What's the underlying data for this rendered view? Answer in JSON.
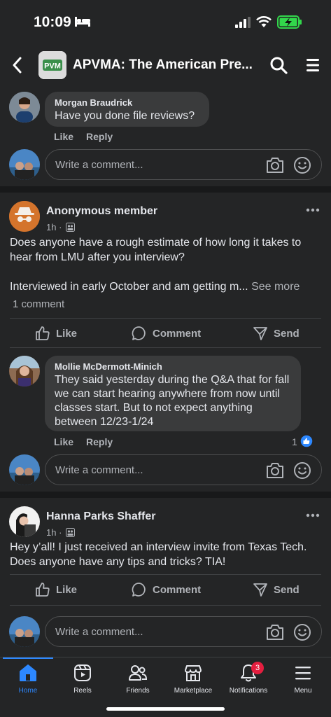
{
  "status": {
    "time": "10:09"
  },
  "header": {
    "group_logo_text": "PVM",
    "title": "APVMA: The American Pre..."
  },
  "comments_top": {
    "author": "Morgan Braudrick",
    "text": "Have you done file reviews?",
    "like": "Like",
    "reply": "Reply",
    "input_placeholder": "Write a comment..."
  },
  "post1": {
    "author": "Anonymous member",
    "time": "1h",
    "text_line1": "Does anyone have a rough estimate of how long it takes to hear from LMU after you interview?",
    "text_line2": "Interviewed in early October and am getting m...",
    "see_more": "See more",
    "comment_count": "1 comment",
    "actions": {
      "like": "Like",
      "comment": "Comment",
      "send": "Send"
    },
    "comment": {
      "author": "Mollie McDermott-Minich",
      "text": "They said yesterday during the Q&A that for fall we can start hearing anywhere from now until classes start. But to not expect anything between 12/23-1/24",
      "like": "Like",
      "reply": "Reply",
      "reactions": "1"
    },
    "input_placeholder": "Write a comment..."
  },
  "post2": {
    "author": "Hanna Parks Shaffer",
    "time": "1h",
    "text": "Hey y’all! I just received an interview invite from Texas Tech. Does anyone have any tips and tricks? TIA!",
    "actions": {
      "like": "Like",
      "comment": "Comment",
      "send": "Send"
    },
    "input_placeholder": "Write a comment..."
  },
  "tabbar": {
    "items": [
      {
        "label": "Home",
        "icon": "home-icon"
      },
      {
        "label": "Reels",
        "icon": "reels-icon"
      },
      {
        "label": "Friends",
        "icon": "friends-icon"
      },
      {
        "label": "Marketplace",
        "icon": "marketplace-icon"
      },
      {
        "label": "Notifications",
        "icon": "bell-icon",
        "badge": "3"
      },
      {
        "label": "Menu",
        "icon": "menu-icon"
      }
    ]
  },
  "colors": {
    "accent": "#2d88ff",
    "background": "#242526",
    "bubble": "#3a3b3c",
    "badge": "#e41e3f"
  }
}
